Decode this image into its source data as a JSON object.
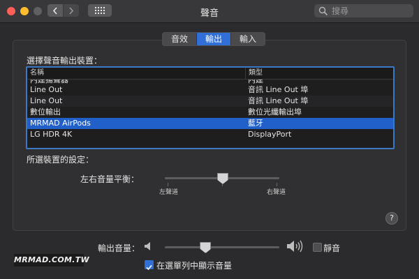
{
  "window": {
    "title": "聲音",
    "search_placeholder": "搜尋"
  },
  "tabs": [
    {
      "label": "音效",
      "active": false
    },
    {
      "label": "輸出",
      "active": true
    },
    {
      "label": "輸入",
      "active": false
    }
  ],
  "output": {
    "section_label": "選擇聲音輸出裝置：",
    "columns": [
      "名稱",
      "類型"
    ],
    "devices": [
      {
        "name": "內建揚聲器",
        "type": "內建",
        "selected": false
      },
      {
        "name": "Line Out",
        "type": "音訊 Line Out 埠",
        "selected": false
      },
      {
        "name": "Line Out",
        "type": "音訊 Line Out 埠",
        "selected": false
      },
      {
        "name": "數位輸出",
        "type": "數位光纖輸出埠",
        "selected": false
      },
      {
        "name": "MRMAD AirPods",
        "type": "藍牙",
        "selected": true
      },
      {
        "name": "LG HDR 4K",
        "type": "DisplayPort",
        "selected": false
      }
    ],
    "settings_label": "所選裝置的設定：",
    "balance_label": "左右音量平衡：",
    "balance_left": "左聲道",
    "balance_right": "右聲道",
    "balance_value": 0.5,
    "help": "?"
  },
  "footer": {
    "volume_label": "輸出音量：",
    "volume_value": 0.35,
    "mute_label": "靜音",
    "mute_checked": false,
    "show_in_menubar_label": "在選單列中顯示音量",
    "show_in_menubar_checked": true,
    "watermark": "MRMAD.COM.TW"
  },
  "colors": {
    "accent": "#2060c8",
    "background": "#2b2b2d"
  }
}
